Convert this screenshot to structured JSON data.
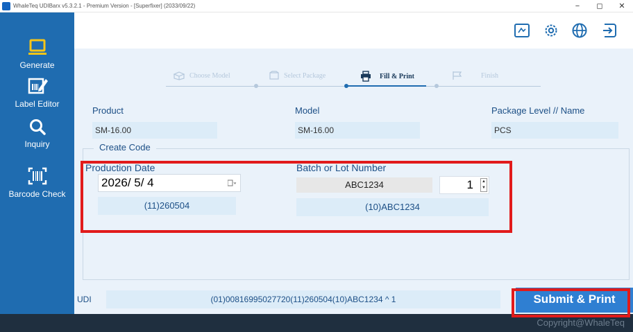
{
  "window": {
    "title": "WhaleTeq UDIBarx v5.3.2.1 - Premium Version - [Superfixer] (2033/09/22)",
    "controls": [
      "−",
      "◻",
      "✕"
    ]
  },
  "sidebar": {
    "items": [
      {
        "label": "Generate",
        "icon": "laptop-icon"
      },
      {
        "label": "Label Editor",
        "icon": "label-edit-icon"
      },
      {
        "label": "Inquiry",
        "icon": "search-icon"
      },
      {
        "label": "Barcode Check",
        "icon": "barcode-scan-icon"
      }
    ]
  },
  "toolbar": {
    "icons": [
      "label-icon",
      "gear-icon",
      "globe-icon",
      "logout-icon"
    ]
  },
  "steps": [
    {
      "label": "Choose Model",
      "state": "done"
    },
    {
      "label": "Select Package",
      "state": "done"
    },
    {
      "label": "Fill & Print",
      "state": "active"
    },
    {
      "label": "Finish",
      "state": "todo"
    }
  ],
  "form": {
    "product_label": "Product",
    "product_value": "SM-16.00",
    "model_label": "Model",
    "model_value": "SM-16.00",
    "package_label": "Package Level // Name",
    "package_value": "PCS"
  },
  "create_code": {
    "title": "Create Code",
    "production_date_label": "Production Date",
    "production_date_value": "2026/ 5/ 4",
    "production_date_code": "(11)260504",
    "batch_label": "Batch or Lot Number",
    "batch_value": "ABC1234",
    "batch_code": "(10)ABC1234",
    "quantity": "1"
  },
  "udi": {
    "label": "UDI",
    "value": "(01)00816995027720(11)260504(10)ABC1234 ^ 1"
  },
  "actions": {
    "submit_label": "Submit & Print"
  },
  "footer": {
    "copyright": "Copyright@WhaleTeq"
  },
  "colors": {
    "sidebar": "#1f6cb0",
    "content": "#eaf2fa",
    "accent": "#2f7fd2",
    "highlight": "#e11b1b"
  }
}
